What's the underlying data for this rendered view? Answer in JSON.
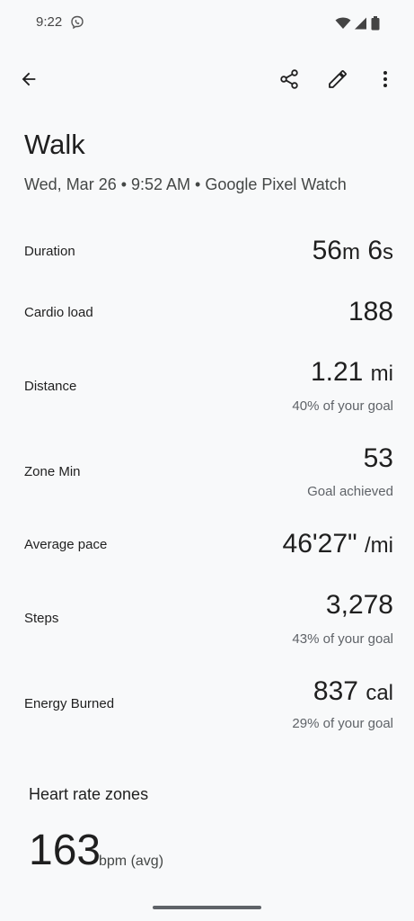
{
  "status": {
    "time": "9:22",
    "icons": [
      "viber-icon",
      "wifi-icon",
      "signal-icon",
      "battery-icon"
    ]
  },
  "app_bar": {
    "icons": [
      "back-arrow-icon",
      "share-icon",
      "edit-icon",
      "more-vert-icon"
    ]
  },
  "activity": {
    "title": "Walk",
    "subtitle": "Wed, Mar 26 • 9:52 AM • Google Pixel Watch"
  },
  "stats": {
    "duration": {
      "label": "Duration",
      "min": "56",
      "min_unit": "m",
      "sec": "6",
      "sec_unit": "s"
    },
    "cardio": {
      "label": "Cardio load",
      "value": "188"
    },
    "distance": {
      "label": "Distance",
      "value": "1.21",
      "unit": "mi",
      "sub": "40% of your goal"
    },
    "zone": {
      "label": "Zone Min",
      "value": "53",
      "sub": "Goal achieved"
    },
    "pace": {
      "label": "Average pace",
      "value": "46'27\"",
      "unit": "/mi"
    },
    "steps": {
      "label": "Steps",
      "value": "3,278",
      "sub": "43% of your goal"
    },
    "energy": {
      "label": "Energy Burned",
      "value": "837",
      "unit": "cal",
      "sub": "29% of your goal"
    }
  },
  "heart_rate": {
    "heading": "Heart rate zones",
    "value": "163",
    "unit": "bpm (avg)"
  },
  "colors": {
    "background": "#f8f9fa",
    "text_primary": "#1f1f1f",
    "text_secondary": "#5f6368"
  }
}
